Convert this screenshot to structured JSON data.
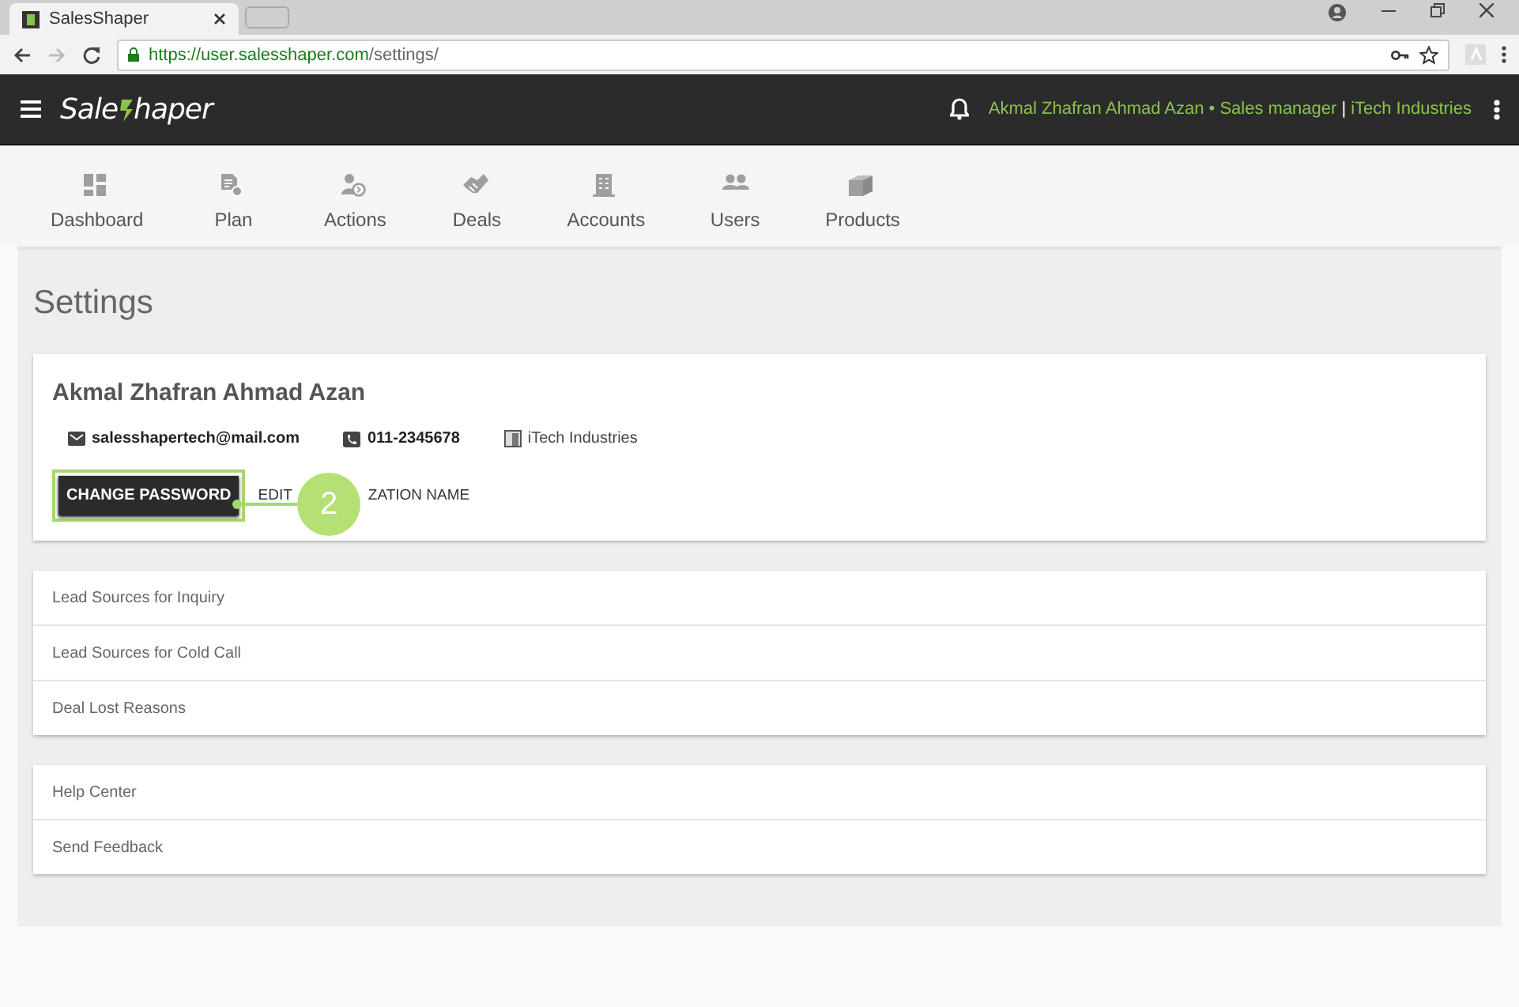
{
  "browser": {
    "tab_title": "SalesShaper",
    "url_host": "https://user.salesshaper.com",
    "url_path": "/settings/"
  },
  "header": {
    "logo_start": "Sale",
    "logo_end": "haper",
    "user": "Akmal Zhafran Ahmad Azan • Sales manager",
    "separator": "|",
    "company": "iTech Industries"
  },
  "nav": [
    {
      "label": "Dashboard"
    },
    {
      "label": "Plan"
    },
    {
      "label": "Actions"
    },
    {
      "label": "Deals"
    },
    {
      "label": "Accounts"
    },
    {
      "label": "Users"
    },
    {
      "label": "Products"
    }
  ],
  "page_title": "Settings",
  "profile": {
    "name": "Akmal Zhafran Ahmad Azan",
    "email": "salesshapertech@mail.com",
    "phone": "011-2345678",
    "organization": "iTech Industries",
    "change_password": "CHANGE PASSWORD",
    "edit_start": "EDIT",
    "edit_end": "ZATION NAME"
  },
  "callout": {
    "number": "2"
  },
  "lists": [
    [
      "Lead Sources for Inquiry",
      "Lead Sources for Cold Call",
      "Deal Lost Reasons"
    ],
    [
      "Help Center",
      "Send Feedback"
    ]
  ]
}
